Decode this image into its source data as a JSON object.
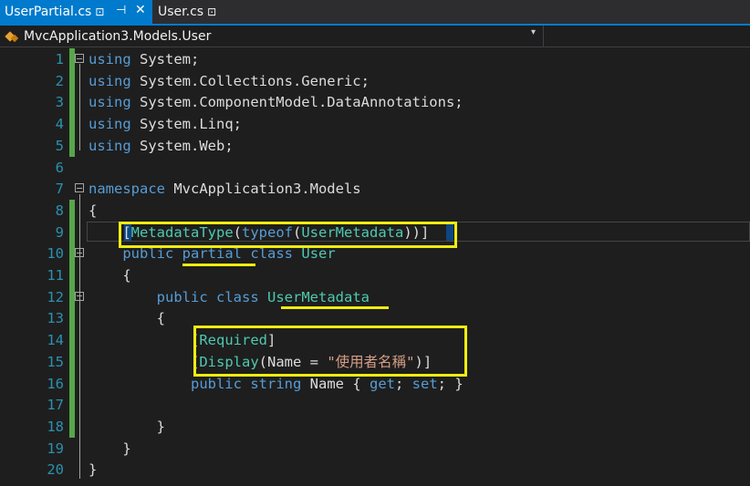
{
  "tabs": [
    {
      "label": "UserPartial.cs",
      "active": true,
      "pin": "⊡",
      "pin2": "⊣",
      "close": "✕"
    },
    {
      "label": "User.cs",
      "active": false,
      "pin": "⊡"
    }
  ],
  "navbar": {
    "class_path": "MvcApplication3.Models.User",
    "dropdown": "▾"
  },
  "colors": {
    "keyword": "#569cd6",
    "type": "#4ec9b0",
    "string": "#d69d85",
    "line_number": "#2b91af",
    "accent": "#007acc",
    "highlight": "#f0ec10"
  },
  "lines": [
    {
      "n": "1",
      "tokens": [
        {
          "t": "using",
          "c": "kw"
        },
        {
          "t": " System;",
          "c": "pl"
        }
      ]
    },
    {
      "n": "2",
      "tokens": [
        {
          "t": "using",
          "c": "kw"
        },
        {
          "t": " System.Collections.Generic;",
          "c": "pl"
        }
      ]
    },
    {
      "n": "3",
      "tokens": [
        {
          "t": "using",
          "c": "kw"
        },
        {
          "t": " System.ComponentModel.DataAnnotations;",
          "c": "pl"
        }
      ]
    },
    {
      "n": "4",
      "tokens": [
        {
          "t": "using",
          "c": "kw"
        },
        {
          "t": " System.Linq;",
          "c": "pl"
        }
      ]
    },
    {
      "n": "5",
      "tokens": [
        {
          "t": "using",
          "c": "kw"
        },
        {
          "t": " System.Web;",
          "c": "pl"
        }
      ]
    },
    {
      "n": "6",
      "tokens": []
    },
    {
      "n": "7",
      "tokens": [
        {
          "t": "namespace",
          "c": "kw"
        },
        {
          "t": " MvcApplication3.Models",
          "c": "pl"
        }
      ]
    },
    {
      "n": "8",
      "tokens": [
        {
          "t": "{",
          "c": "pl"
        }
      ]
    },
    {
      "n": "9",
      "tokens": [
        {
          "t": "    [",
          "c": "pl"
        },
        {
          "t": "MetadataType",
          "c": "ty"
        },
        {
          "t": "(",
          "c": "pl"
        },
        {
          "t": "typeof",
          "c": "kw"
        },
        {
          "t": "(",
          "c": "pl"
        },
        {
          "t": "UserMetadata",
          "c": "ty"
        },
        {
          "t": "))]",
          "c": "pl"
        }
      ]
    },
    {
      "n": "10",
      "tokens": [
        {
          "t": "    ",
          "c": "pl"
        },
        {
          "t": "public",
          "c": "kw"
        },
        {
          "t": " ",
          "c": "pl"
        },
        {
          "t": "partial",
          "c": "kw"
        },
        {
          "t": " ",
          "c": "pl"
        },
        {
          "t": "class",
          "c": "kw"
        },
        {
          "t": " ",
          "c": "pl"
        },
        {
          "t": "User",
          "c": "ty"
        }
      ]
    },
    {
      "n": "11",
      "tokens": [
        {
          "t": "    {",
          "c": "pl"
        }
      ]
    },
    {
      "n": "12",
      "tokens": [
        {
          "t": "        ",
          "c": "pl"
        },
        {
          "t": "public",
          "c": "kw"
        },
        {
          "t": " ",
          "c": "pl"
        },
        {
          "t": "class",
          "c": "kw"
        },
        {
          "t": " ",
          "c": "pl"
        },
        {
          "t": "UserMetadata",
          "c": "ty"
        }
      ]
    },
    {
      "n": "13",
      "tokens": [
        {
          "t": "        {",
          "c": "pl"
        }
      ]
    },
    {
      "n": "14",
      "tokens": [
        {
          "t": "            [",
          "c": "pl"
        },
        {
          "t": "Required",
          "c": "ty"
        },
        {
          "t": "]",
          "c": "pl"
        }
      ]
    },
    {
      "n": "15",
      "tokens": [
        {
          "t": "            [",
          "c": "pl"
        },
        {
          "t": "Display",
          "c": "ty"
        },
        {
          "t": "(Name = ",
          "c": "pl"
        },
        {
          "t": "\"使用者名稱\"",
          "c": "st"
        },
        {
          "t": ")]",
          "c": "pl"
        }
      ]
    },
    {
      "n": "16",
      "tokens": [
        {
          "t": "            ",
          "c": "pl"
        },
        {
          "t": "public",
          "c": "kw"
        },
        {
          "t": " ",
          "c": "pl"
        },
        {
          "t": "string",
          "c": "kw"
        },
        {
          "t": " Name { ",
          "c": "pl"
        },
        {
          "t": "get",
          "c": "kw"
        },
        {
          "t": "; ",
          "c": "pl"
        },
        {
          "t": "set",
          "c": "kw"
        },
        {
          "t": "; }",
          "c": "pl"
        }
      ]
    },
    {
      "n": "17",
      "tokens": []
    },
    {
      "n": "18",
      "tokens": [
        {
          "t": "        }",
          "c": "pl"
        }
      ]
    },
    {
      "n": "19",
      "tokens": [
        {
          "t": "    }",
          "c": "pl"
        }
      ]
    },
    {
      "n": "20",
      "tokens": [
        {
          "t": "}",
          "c": "pl"
        }
      ]
    }
  ]
}
